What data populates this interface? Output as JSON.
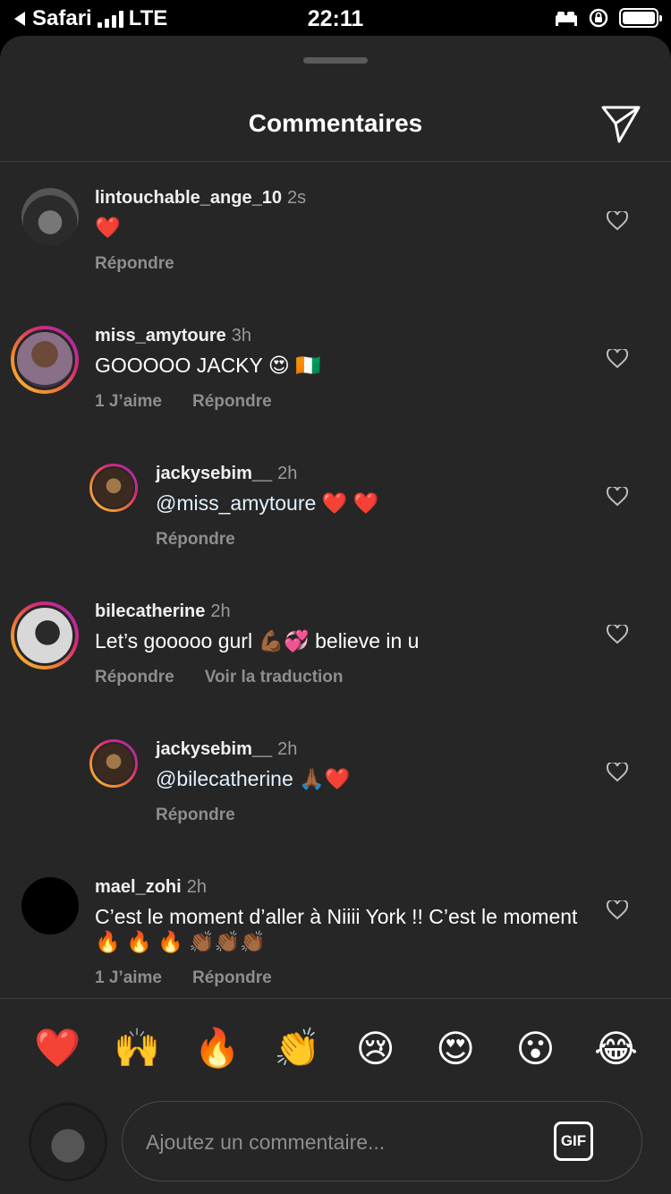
{
  "status_bar": {
    "back_app": "Safari",
    "network": "LTE",
    "time": "22:11"
  },
  "header": {
    "title": "Commentaires"
  },
  "comments": [
    {
      "user": "lintouchable_ange_10",
      "time": "2s",
      "text": "❤️",
      "likes": "",
      "reply": "Répondre",
      "extra": ""
    },
    {
      "user": "miss_amytoure",
      "time": "3h",
      "text": "GOOOOO JACKY 😍 🇨🇮",
      "likes": "1 J’aime",
      "reply": "Répondre",
      "extra": ""
    },
    {
      "user": "jackysebim__",
      "time": "2h",
      "text": "@miss_amytoure ❤️ ❤️",
      "likes": "",
      "reply": "Répondre",
      "extra": ""
    },
    {
      "user": "bilecatherine",
      "time": "2h",
      "text": "Let’s gooooo gurl 💪🏾💞 believe in u",
      "likes": "",
      "reply": "Répondre",
      "extra": "Voir la traduction"
    },
    {
      "user": "jackysebim__",
      "time": "2h",
      "text": "@bilecatherine 🙏🏾❤️",
      "likes": "",
      "reply": "Répondre",
      "extra": ""
    },
    {
      "user": "mael_zohi",
      "time": "2h",
      "text": "C’est le moment d’aller à Niiii York !! C’est le moment 🔥 🔥 🔥 👏🏾👏🏾👏🏾",
      "likes": "1 J’aime",
      "reply": "Répondre",
      "extra": ""
    }
  ],
  "quick_emojis": [
    "❤️",
    "🙌",
    "🔥",
    "👏",
    "😢",
    "😍",
    "😮",
    "😂"
  ],
  "composer": {
    "placeholder": "Ajoutez un commentaire...",
    "gif_label": "GIF"
  }
}
